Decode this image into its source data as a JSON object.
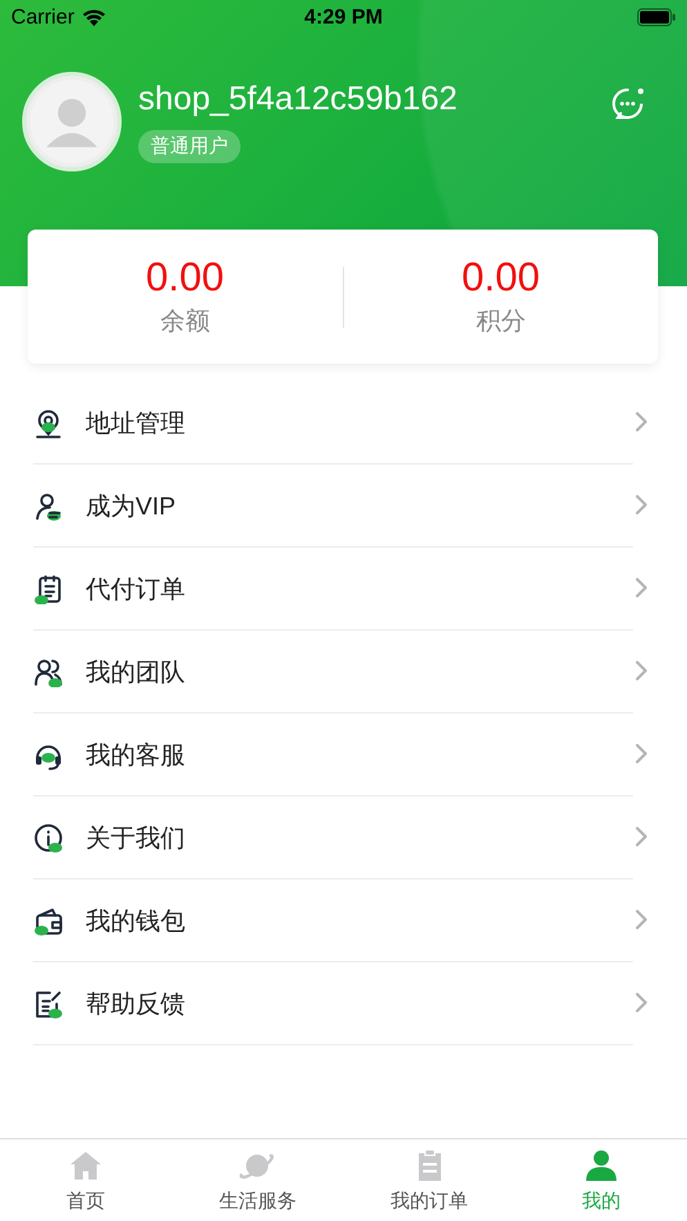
{
  "status_bar": {
    "carrier": "Carrier",
    "time": "4:29 PM"
  },
  "profile": {
    "username": "shop_5f4a12c59b162",
    "role": "普通用户"
  },
  "stats": [
    {
      "value": "0.00",
      "label": "余额"
    },
    {
      "value": "0.00",
      "label": "积分"
    }
  ],
  "menu": [
    {
      "kind": "location",
      "label": "地址管理"
    },
    {
      "kind": "vip",
      "label": "成为VIP"
    },
    {
      "kind": "order",
      "label": "代付订单"
    },
    {
      "kind": "team",
      "label": "我的团队"
    },
    {
      "kind": "service",
      "label": "我的客服"
    },
    {
      "kind": "about",
      "label": "关于我们"
    },
    {
      "kind": "wallet",
      "label": "我的钱包"
    },
    {
      "kind": "feedback",
      "label": "帮助反馈"
    }
  ],
  "tab_bar": [
    {
      "kind": "home",
      "label": "首页",
      "selected": false
    },
    {
      "kind": "planet",
      "label": "生活服务",
      "selected": false
    },
    {
      "kind": "clipboard",
      "label": "我的订单",
      "selected": false
    },
    {
      "kind": "person",
      "label": "我的",
      "selected": true
    }
  ]
}
